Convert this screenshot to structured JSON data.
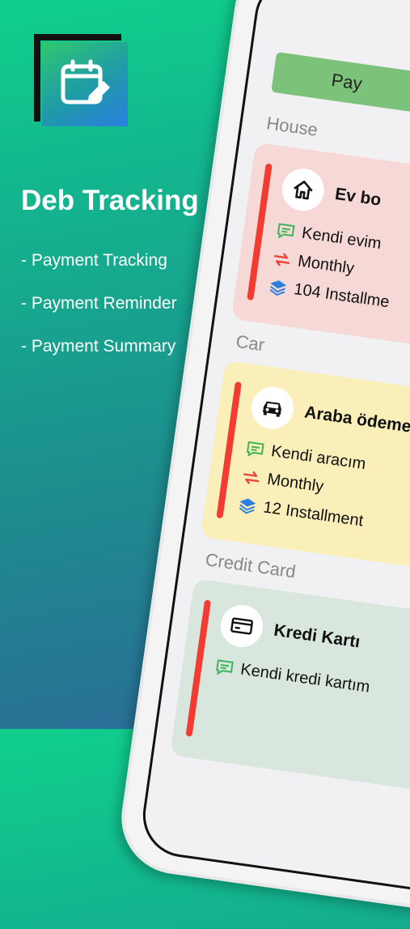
{
  "app": {
    "title": "Deb Tracking",
    "features": [
      "- Payment Tracking",
      "- Payment Reminder",
      "- Payment Summary"
    ]
  },
  "screen": {
    "pay_button_label": "Pay",
    "sections": [
      {
        "label": "House",
        "color": "#f6d9d6",
        "icon": "house-icon",
        "title": "Ev bo",
        "description": "Kendi evim",
        "frequency": "Monthly",
        "installments": "104 Installme"
      },
      {
        "label": "Car",
        "color": "#fbefb9",
        "icon": "car-icon",
        "title": "Araba ödeme",
        "description": "Kendi aracım",
        "frequency": "Monthly",
        "installments": "12 Installment"
      },
      {
        "label": "Credit Card",
        "color": "#d9e6dd",
        "icon": "credit-card-icon",
        "title": "Kredi Kartı",
        "description": "Kendi kredi kartım",
        "frequency": "",
        "installments": ""
      }
    ]
  },
  "colors": {
    "accent_bar": "#f23b32",
    "pay_button": "#7dc27a",
    "comment_icon": "#3fb55a",
    "repeat_icon": "#e8453c",
    "layers_icon": "#2a7fe0"
  }
}
